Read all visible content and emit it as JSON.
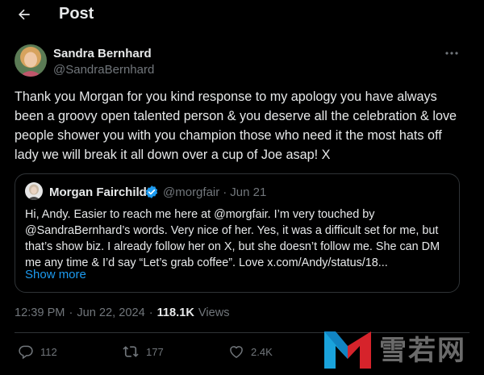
{
  "header": {
    "title": "Post"
  },
  "post": {
    "author_name": "Sandra Bernhard",
    "author_handle": "@SandraBernhard",
    "text": "Thank you Morgan for you kind response to my apology you have always been a groovy open talented person & you deserve  all the celebration & love people shower you with you champion those who need it the most hats off lady we will break it all down over a cup of Joe asap! X"
  },
  "quote": {
    "name": "Morgan Fairchild",
    "handle": "@morgfair",
    "separator": "·",
    "date": "Jun 21",
    "text": "Hi, Andy. Easier to reach me here at @morgfair. I’m very touched by @SandraBernhard’s words. Very nice of her. Yes, it was a difficult set for me, but that’s show biz. I already follow her on X, but she doesn’t follow me. She can DM me any time & I’d say “Let’s grab coffee”. Love x.com/Andy/status/18...",
    "show_more": "Show more"
  },
  "timestamp": {
    "time": "12:39 PM",
    "separator": "·",
    "date": "Jun 22, 2024",
    "separator2": "·",
    "views_count": "118.1K",
    "views_label": "Views"
  },
  "actions": {
    "replies": "112",
    "reposts": "177",
    "likes": "2.4K"
  },
  "watermark": {
    "text": "雪若网"
  },
  "colors": {
    "background": "#000000",
    "text": "#e7e9ea",
    "muted": "#71767b",
    "accent": "#1d9bf0",
    "border": "#2f3336"
  },
  "icons": [
    "back-arrow-icon",
    "more-icon",
    "verified-icon",
    "reply-icon",
    "repost-icon",
    "like-icon",
    "watermark-logo"
  ]
}
